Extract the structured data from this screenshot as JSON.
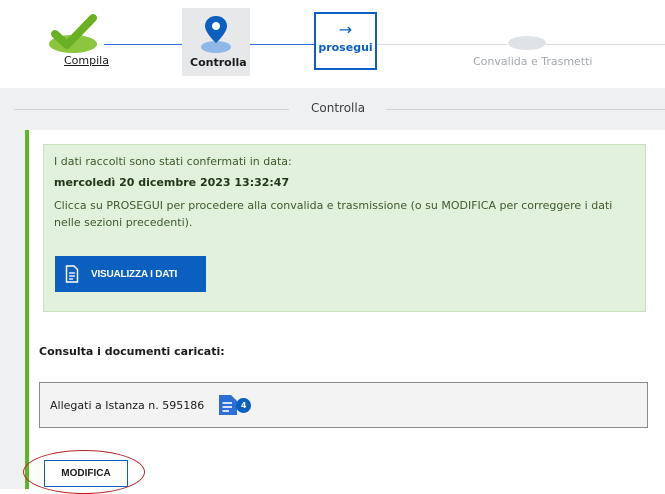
{
  "stepper": {
    "steps": [
      {
        "label": "Compila",
        "state": "done"
      },
      {
        "label": "Controlla",
        "state": "current"
      },
      {
        "label": "prosegui",
        "state": "action"
      },
      {
        "label": "Convalida e Trasmetti",
        "state": "pending"
      }
    ],
    "prosegui_arrow": "→"
  },
  "section": {
    "title": "Controlla"
  },
  "alert": {
    "line1": "I dati raccolti sono stati confermati in data:",
    "date": "mercoledì 20 dicembre 2023 13:32:47",
    "info": "Clicca su PROSEGUI per procedere alla convalida e trasmissione (o su MODIFICA per correggere i dati nelle sezioni precedenti).",
    "button_label": "VISUALIZZA I DATI"
  },
  "documents": {
    "heading": "Consulta i documenti caricati:",
    "attachment_label": "Allegati a Istanza n. 595186",
    "count": "4"
  },
  "actions": {
    "modifica_label": "MODIFICA"
  },
  "colors": {
    "primary": "#0b5fbf",
    "success": "#5fb527",
    "alert_bg": "#e2f1dc",
    "highlight": "#b3262a"
  },
  "icons": [
    "check-icon",
    "location-pin-icon",
    "arrow-right-icon",
    "document-icon",
    "attachments-icon"
  ]
}
